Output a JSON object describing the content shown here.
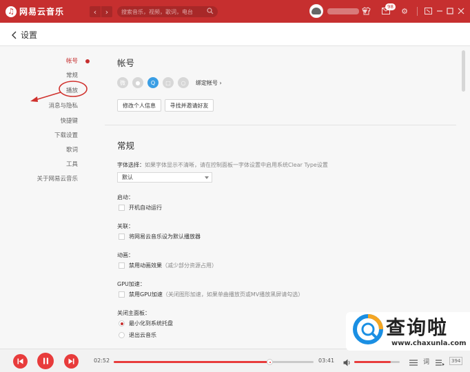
{
  "titlebar": {
    "app_name": "网易云音乐",
    "search_placeholder": "搜索音乐，视频，歌词，电台",
    "message_count": "98",
    "colors": {
      "brand": "#c62f2f",
      "bar_dark": "#a82828"
    }
  },
  "header": {
    "back_label": "设置"
  },
  "sidebar": {
    "items": [
      {
        "label": "帐号",
        "active": true
      },
      {
        "label": "常规"
      },
      {
        "label": "播放"
      },
      {
        "label": "消息与隐私"
      },
      {
        "label": "快捷键"
      },
      {
        "label": "下载设置"
      },
      {
        "label": "歌词"
      },
      {
        "label": "工具"
      },
      {
        "label": "关于网易云音乐"
      }
    ]
  },
  "account": {
    "title": "帐号",
    "bind_label": "绑定帐号",
    "social_icons": [
      "weibo-icon",
      "wechat-icon",
      "qq-icon",
      "renren-icon",
      "yixin-icon"
    ],
    "edit_profile_label": "修改个人信息",
    "find_friends_label": "寻找并邀请好友"
  },
  "general": {
    "title": "常规",
    "font_label": "字体选择：",
    "font_hint": "如果字体显示不清晰，请在控制面板一字体设置中启用系统Clear Type设置",
    "font_value": "默认",
    "startup_label": "启动：",
    "startup_option": "开机自动运行",
    "assoc_label": "关联：",
    "assoc_option": "将网易云音乐设为默认播放器",
    "anim_label": "动画：",
    "anim_option": "禁用动画效果",
    "anim_hint": "（减少部分资源占用）",
    "gpu_label": "GPU加速：",
    "gpu_option": "禁用GPU加速",
    "gpu_hint": "（关闭图形加速，如果单曲播放页或MV播放黑屏请勾选）",
    "close_label": "关闭主面板：",
    "close_options": [
      {
        "label": "最小化到系统托盘",
        "selected": true
      },
      {
        "label": "退出云音乐",
        "selected": false
      }
    ]
  },
  "player": {
    "current_time": "02:52",
    "total_time": "03:41",
    "progress": 0.78,
    "volume": 0.8,
    "playlist_count": "394",
    "accent": "#e83c3c"
  },
  "watermark": {
    "title": "查询啦",
    "url": "www.chaxunla.com"
  }
}
